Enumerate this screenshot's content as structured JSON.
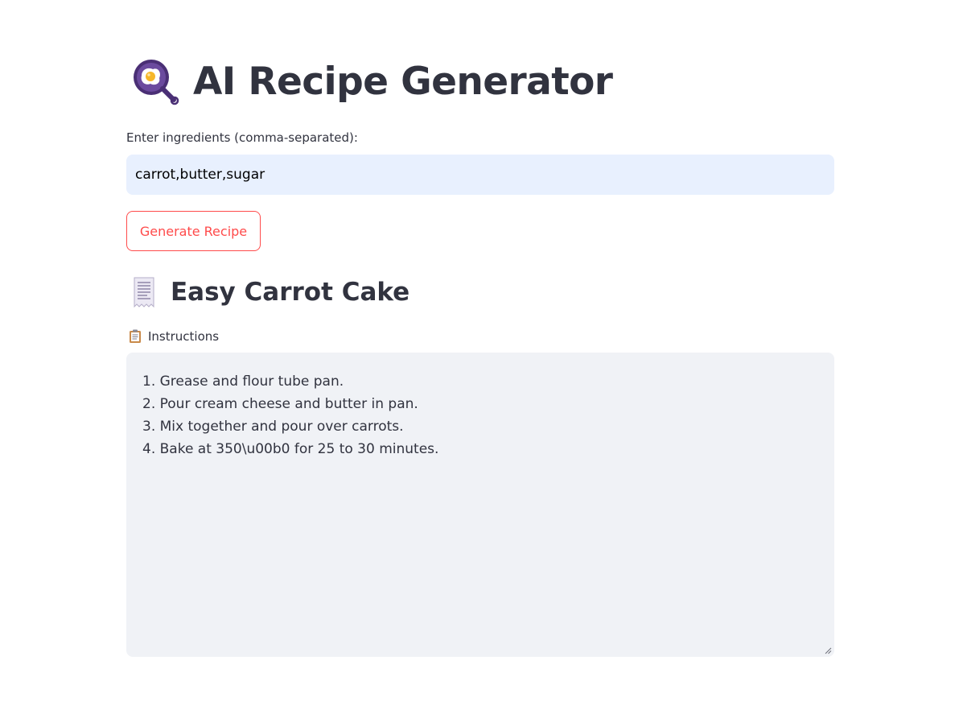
{
  "header": {
    "title": "AI Recipe Generator",
    "icon": "frying-pan-icon"
  },
  "ingredients": {
    "label": "Enter ingredients (comma-separated):",
    "value": "carrot,butter,sugar"
  },
  "generate_button": {
    "label": "Generate Recipe"
  },
  "recipe": {
    "icon": "receipt-icon",
    "title": "Easy Carrot Cake",
    "instructions_icon": "clipboard-icon",
    "instructions_label": "Instructions",
    "instructions": [
      "1. Grease and flour tube pan.",
      "2. Pour cream cheese and butter in pan.",
      "3. Mix together and pour over carrots.",
      "4. Bake at 350\\u00b0 for 25 to 30 minutes."
    ]
  },
  "colors": {
    "accent": "#ff4b4b",
    "text": "#31333f",
    "input_bg": "#e8f0fe",
    "textarea_bg": "#f0f2f6",
    "pan": "#5b3d8a"
  }
}
